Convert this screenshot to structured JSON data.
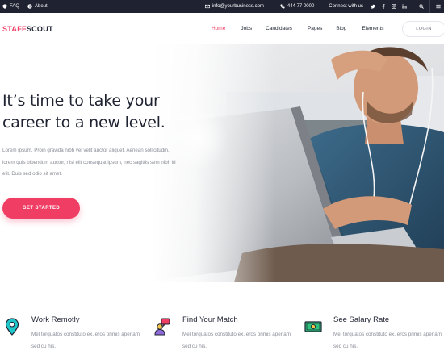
{
  "topbar": {
    "faq": "FAQ",
    "about": "About",
    "email": "info@yourbusiness.com",
    "phone": "444 77 0000",
    "connect": "Connect with us",
    "social": [
      "twitter-icon",
      "facebook-icon",
      "instagram-icon",
      "linkedin-icon"
    ]
  },
  "header": {
    "logo_part1": "STAFF",
    "logo_part2": "SCOUT",
    "nav": [
      "Home",
      "Jobs",
      "Candidates",
      "Pages",
      "Blog",
      "Elements"
    ],
    "active_nav": "Home",
    "login": "LOGIN"
  },
  "hero": {
    "title": "It’s time to take your career to a new level.",
    "text": "Lorem ipsum. Proin gravida nibh vel velit auctor aliquet. Aenean sollicitudin, lorem quis bibendum auctor, nisi elit consequat ipsum, nec sagittis sem nibh id elit. Duis sed odio sit amet.",
    "cta": "GET STARTED"
  },
  "features": [
    {
      "icon": "location-pin-icon",
      "title": "Work Remotly",
      "text": "Mel torquatos constituto ex, eros primis aperiam sed cu his."
    },
    {
      "icon": "chat-person-icon",
      "title": "Find Your Match",
      "text": "Mel torquatos constituto ex, eros primis aperiam sed cu his."
    },
    {
      "icon": "money-icon",
      "title": "See Salary Rate",
      "text": "Mel torquatos constituto ex, eros primis aperiam sed cu his."
    }
  ],
  "colors": {
    "accent": "#ef3d64",
    "dark": "#1e2231",
    "muted": "#8a8d99"
  }
}
